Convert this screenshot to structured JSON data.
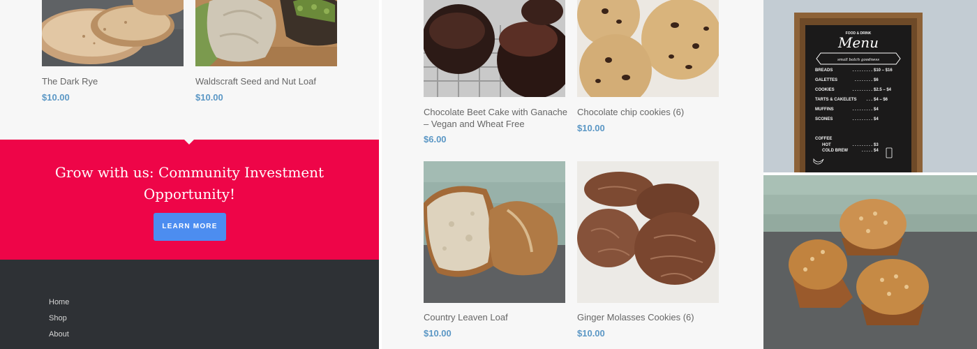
{
  "left_products": [
    {
      "name": "The Dark Rye",
      "price": "$10.00",
      "image": "sliced-rye-bread"
    },
    {
      "name": "Waldscraft Seed and Nut Loaf",
      "price": "$10.00",
      "image": "seed-loaf-with-linen"
    }
  ],
  "promo": {
    "title": "Grow with us: Community Investment Opportunity!",
    "button_label": "LEARN MORE"
  },
  "footer_links": [
    "Home",
    "Shop",
    "About"
  ],
  "mid_products": [
    {
      "name": "Chocolate Beet Cake with Ganache – Vegan and Wheat Free",
      "price": "$6.00",
      "image": "chocolate-bundt-cakes"
    },
    {
      "name": "Chocolate chip cookies (6)",
      "price": "$10.00",
      "image": "chocolate-chip-cookies"
    },
    {
      "name": "Country Leaven Loaf",
      "price": "$10.00",
      "image": "country-leaven-loaf"
    },
    {
      "name": "Ginger Molasses Cookies (6)",
      "price": "$10.00",
      "image": "ginger-molasses-cookies"
    }
  ],
  "menu_board": {
    "header": "FOOD & DRINK",
    "title": "Menu",
    "ribbon": "small batch goodness",
    "items": [
      {
        "name": "BREADS",
        "dots": ". . . . . . . . .",
        "price": "$10 – $16"
      },
      {
        "name": "GALETTES",
        "dots": ". . . . . . . .",
        "price": "$6"
      },
      {
        "name": "COOKIES",
        "dots": ". . . . . . . . .",
        "price": "$2.5 – $4"
      },
      {
        "name": "TARTS & CAKELETS",
        "dots": ". . .",
        "price": "$4 – $6"
      },
      {
        "name": "MUFFINS",
        "dots": ". . . . . . . . .",
        "price": "$4"
      },
      {
        "name": "SCONES",
        "dots": ". . . . . . . . .",
        "price": "$4"
      }
    ],
    "coffee_label": "COFFEE",
    "coffee_items": [
      {
        "name": "HOT",
        "dots": ". . . . . . . . .",
        "price": "$3"
      },
      {
        "name": "COLD BREW",
        "dots": ". . . . .",
        "price": "$4"
      }
    ]
  },
  "side_images": [
    "chalkboard-menu-photo",
    "oat-muffins-photo"
  ],
  "colors": {
    "promo_bg": "#ee0548",
    "button": "#4c8df0",
    "price": "#5b97c5",
    "footer_bg": "#2e3135"
  }
}
